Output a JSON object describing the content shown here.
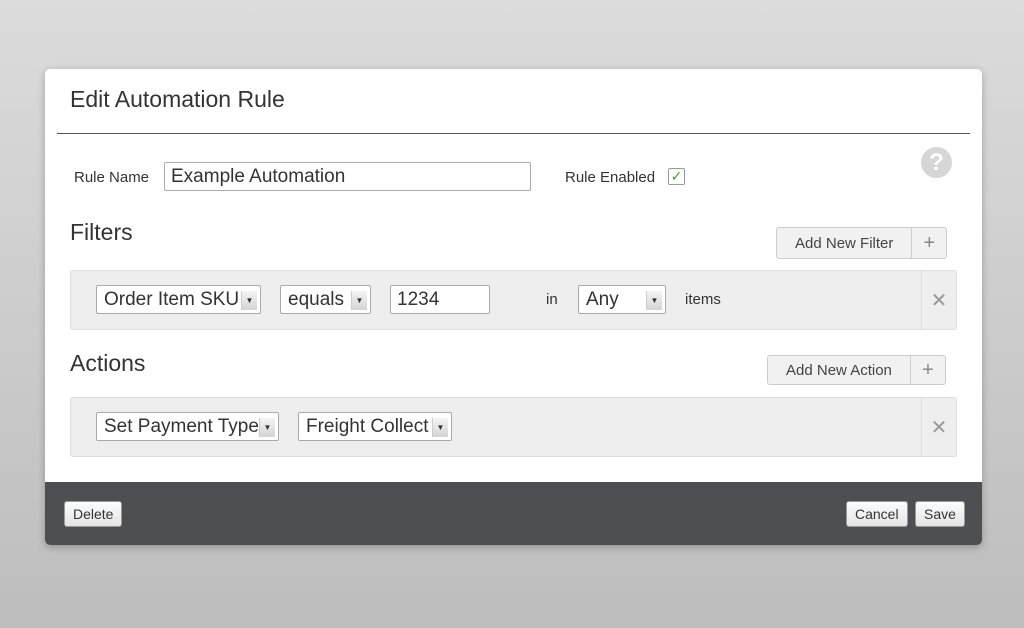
{
  "dialog": {
    "title": "Edit Automation Rule",
    "help_icon": "?",
    "rule_name": {
      "label": "Rule Name",
      "value": "Example Automation"
    },
    "rule_enabled": {
      "label": "Rule Enabled",
      "checked": true,
      "check_glyph": "✓"
    }
  },
  "filters": {
    "title": "Filters",
    "add_label": "Add New Filter",
    "add_icon": "+",
    "rows": [
      {
        "field": "Order Item SKU",
        "operator": "equals",
        "value": "1234",
        "in_label": "in",
        "quantifier": "Any",
        "items_label": "items",
        "remove_icon": "✕"
      }
    ]
  },
  "actions": {
    "title": "Actions",
    "add_label": "Add New Action",
    "add_icon": "+",
    "rows": [
      {
        "action": "Set Payment Type",
        "value": "Freight Collect",
        "remove_icon": "✕"
      }
    ]
  },
  "footer": {
    "delete_label": "Delete",
    "cancel_label": "Cancel",
    "save_label": "Save"
  },
  "icons": {
    "dropdown_arrow": "▼"
  },
  "colors": {
    "footer_bg": "#4e4f53",
    "checkbox_check": "#4a9a20"
  }
}
